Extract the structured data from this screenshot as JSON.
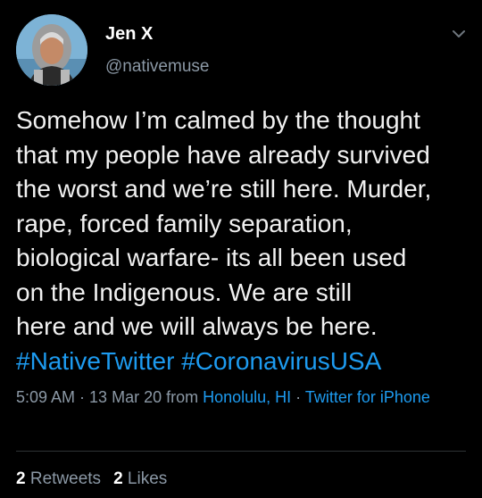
{
  "author": {
    "display_name": "Jen X",
    "handle": "@nativemuse"
  },
  "menu": {
    "icon": "chevron-down-icon"
  },
  "tweet": {
    "lines": [
      "Somehow I’m calmed by the thought",
      "that my people have already survived",
      "the worst and we’re still here. Murder,",
      "rape, forced family separation,",
      "biological warfare- its all been used",
      "on the Indigenous. We are still",
      "here and we will always be here."
    ],
    "hashtags": [
      "#NativeTwitter",
      "#CoronavirusUSA"
    ]
  },
  "meta": {
    "time": "5:09 AM",
    "sep1": " · ",
    "date": "13 Mar 20",
    "from": " from ",
    "location": "Honolulu, HI",
    "sep2": " · ",
    "client": "Twitter for iPhone"
  },
  "stats": {
    "retweets_count": "2",
    "retweets_label": "Retweets",
    "likes_count": "2",
    "likes_label": "Likes"
  },
  "colors": {
    "background": "#000000",
    "link": "#1d9bf0",
    "muted": "#8b98a5"
  }
}
